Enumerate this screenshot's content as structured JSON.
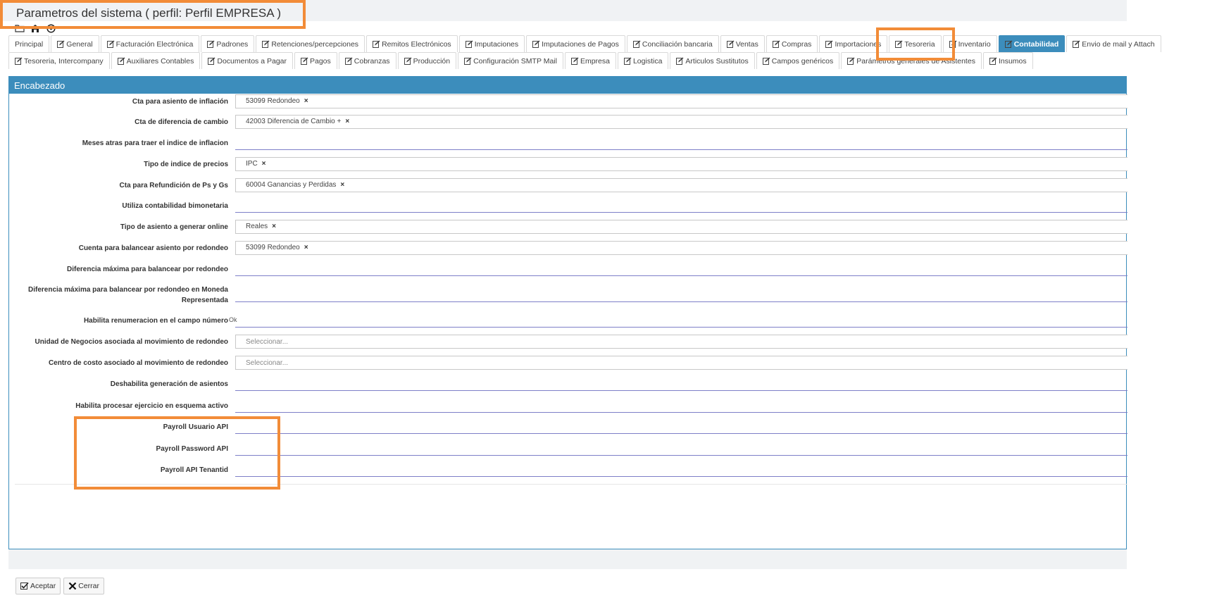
{
  "window": {
    "title": "Parametros del sistema ( perfil: Perfil EMPRESA )"
  },
  "toolbar": {
    "icons": [
      "folder-icon",
      "save-icon",
      "help-icon"
    ]
  },
  "tabs_row1": [
    {
      "label": "Principal",
      "icon": false
    },
    {
      "label": "General",
      "icon": true
    },
    {
      "label": "Facturación Electrónica",
      "icon": true
    },
    {
      "label": "Padrones",
      "icon": true
    },
    {
      "label": "Retenciones/percepciones",
      "icon": true
    },
    {
      "label": "Remitos Electrónicos",
      "icon": true
    },
    {
      "label": "Imputaciones",
      "icon": true
    },
    {
      "label": "Imputaciones de Pagos",
      "icon": true
    },
    {
      "label": "Conciliación bancaria",
      "icon": true
    },
    {
      "label": "Ventas",
      "icon": true
    },
    {
      "label": "Compras",
      "icon": true
    },
    {
      "label": "Importaciones",
      "icon": true
    },
    {
      "label": "Tesoreria",
      "icon": true
    },
    {
      "label": "Inventario",
      "icon": true
    },
    {
      "label": "Contabilidad",
      "icon": true,
      "active": true
    },
    {
      "label": "Envio de mail y Attach",
      "icon": true
    }
  ],
  "tabs_row2": [
    {
      "label": "Tesoreria, Intercompany",
      "icon": true
    },
    {
      "label": "Auxiliares Contables",
      "icon": true
    },
    {
      "label": "Documentos a Pagar",
      "icon": true
    },
    {
      "label": "Pagos",
      "icon": true
    },
    {
      "label": "Cobranzas",
      "icon": true
    },
    {
      "label": "Producción",
      "icon": true
    },
    {
      "label": "Configuración SMTP Mail",
      "icon": true
    },
    {
      "label": "Empresa",
      "icon": true
    },
    {
      "label": "Logistica",
      "icon": true
    },
    {
      "label": "Articulos Sustitutos",
      "icon": true
    },
    {
      "label": "Campos genéricos",
      "icon": true
    },
    {
      "label": "Parámetros generales de Asistentes",
      "icon": true
    },
    {
      "label": "Insumos",
      "icon": true
    }
  ],
  "section": {
    "title": "Encabezado"
  },
  "fields": [
    {
      "label": "Cta para asiento de inflación",
      "type": "tag",
      "value": "53099 Redondeo"
    },
    {
      "label": "Cta de diferencia de cambio",
      "type": "tag",
      "value": "42003 Diferencia de Cambio +"
    },
    {
      "label": "Meses atras para traer el indice de inflacion",
      "type": "text",
      "value": ""
    },
    {
      "label": "Tipo de indice de precios",
      "type": "tag",
      "value": "IPC"
    },
    {
      "label": "Cta para Refundición de Ps y Gs",
      "type": "tag",
      "value": "60004 Ganancias y Perdidas"
    },
    {
      "label": "Utiliza contabilidad bimonetaria",
      "type": "text",
      "value": ""
    },
    {
      "label": "Tipo de asiento a generar online",
      "type": "tag",
      "value": "Reales"
    },
    {
      "label": "Cuenta para balancear asiento por redondeo",
      "type": "tag",
      "value": "53099 Redondeo"
    },
    {
      "label": "Diferencia máxima para balancear por redondeo",
      "type": "text",
      "value": ""
    },
    {
      "label": "Diferencia máxima para balancear por redondeo en Moneda Representada",
      "type": "text",
      "value": ""
    },
    {
      "label": "Habilita renumeracion en el campo número",
      "type": "check",
      "value": "Ok"
    },
    {
      "label": "Unidad de Negocios asociada al movimiento de redondeo",
      "type": "select",
      "placeholder": "Seleccionar..."
    },
    {
      "label": "Centro de costo asociado al movimiento de redondeo",
      "type": "select",
      "placeholder": "Seleccionar..."
    },
    {
      "label": "Deshabilita generación de asientos",
      "type": "text",
      "value": ""
    },
    {
      "label": "Habilita procesar ejercicio en esquema activo",
      "type": "text",
      "value": ""
    },
    {
      "label": "Payroll Usuario API",
      "type": "text",
      "value": ""
    },
    {
      "label": "Payroll Password API",
      "type": "text",
      "value": ""
    },
    {
      "label": "Payroll API Tenantid",
      "type": "text",
      "value": ""
    }
  ],
  "buttons": {
    "accept": "Aceptar",
    "close": "Cerrar"
  },
  "colors": {
    "accent": "#3c8dbc",
    "highlight": "#f28c38",
    "underline": "#7d7fc8"
  }
}
